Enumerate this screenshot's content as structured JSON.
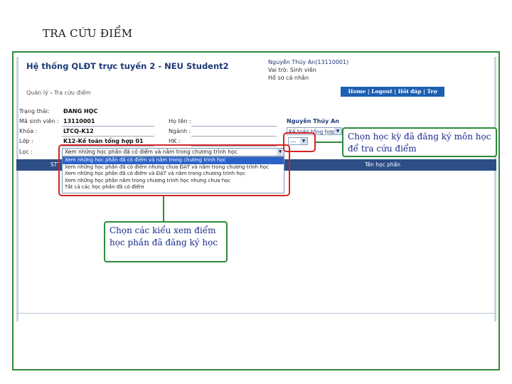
{
  "slide_title": "TRA CỨU ĐIỂM",
  "app": {
    "title": "Hệ thống QLĐT trực tuyến 2 - NEU Student2",
    "user_name_line": "Nguyễn Thúy An(13110001)",
    "role_line": "Vai trò: Sinh viên",
    "profile_link": "Hồ sơ cá nhân",
    "breadcrumb": "Quản lý › Tra cứu điểm"
  },
  "navbar": {
    "label": "Home | Logout | Hỏi đáp | Trợ giúp"
  },
  "form": {
    "status_label": "Trạng thái:",
    "status_value": "ĐANG HỌC",
    "student_id_label": "Mã sinh viên :",
    "student_id_value": "13110001",
    "fullname_label": "Họ tên :",
    "fullname_value": "Nguyễn Thúy An",
    "course_label": "Khóa :",
    "course_value": "LTCQ-K12",
    "major_label": "Ngành :",
    "major_value": "Kế toán tổng hợp",
    "class_label": "Lớp :",
    "class_value": "K12-Kế toán tổng hợp 01",
    "semester_label": "HK :",
    "semester_value": "---",
    "filter_label": "Lọc :",
    "filter_selected": "Xem những học phần đã có điểm và nằm trong chương trình học",
    "filter_options": [
      "Xem những học phần đã có điểm và nằm trong chương trình học",
      "Xem những học phần đã có điểm nhưng chưa ĐẠT và nằm trong chương trình học",
      "Xem những học phần đã có điểm và ĐẠT và nằm trong chương trình học",
      "Xem những học phần nằm trong chương trình học nhưng chưa học",
      "Tất cả các học phần đã có điểm"
    ]
  },
  "table": {
    "col_stt": "STT",
    "col_name": "Tên học phần"
  },
  "callouts": {
    "semester_note": "Chọn học kỳ đã đăng ký môn học để tra cứu điểm",
    "filter_note": "Chọn các kiểu xem điểm học phần đã đăng ký học"
  },
  "colors": {
    "accent_green": "#2e8b3a",
    "highlight_red": "#d42424",
    "header_blue": "#2d4e86",
    "nav_blue": "#1d5fb3",
    "callout_text": "#1a2b8c"
  }
}
